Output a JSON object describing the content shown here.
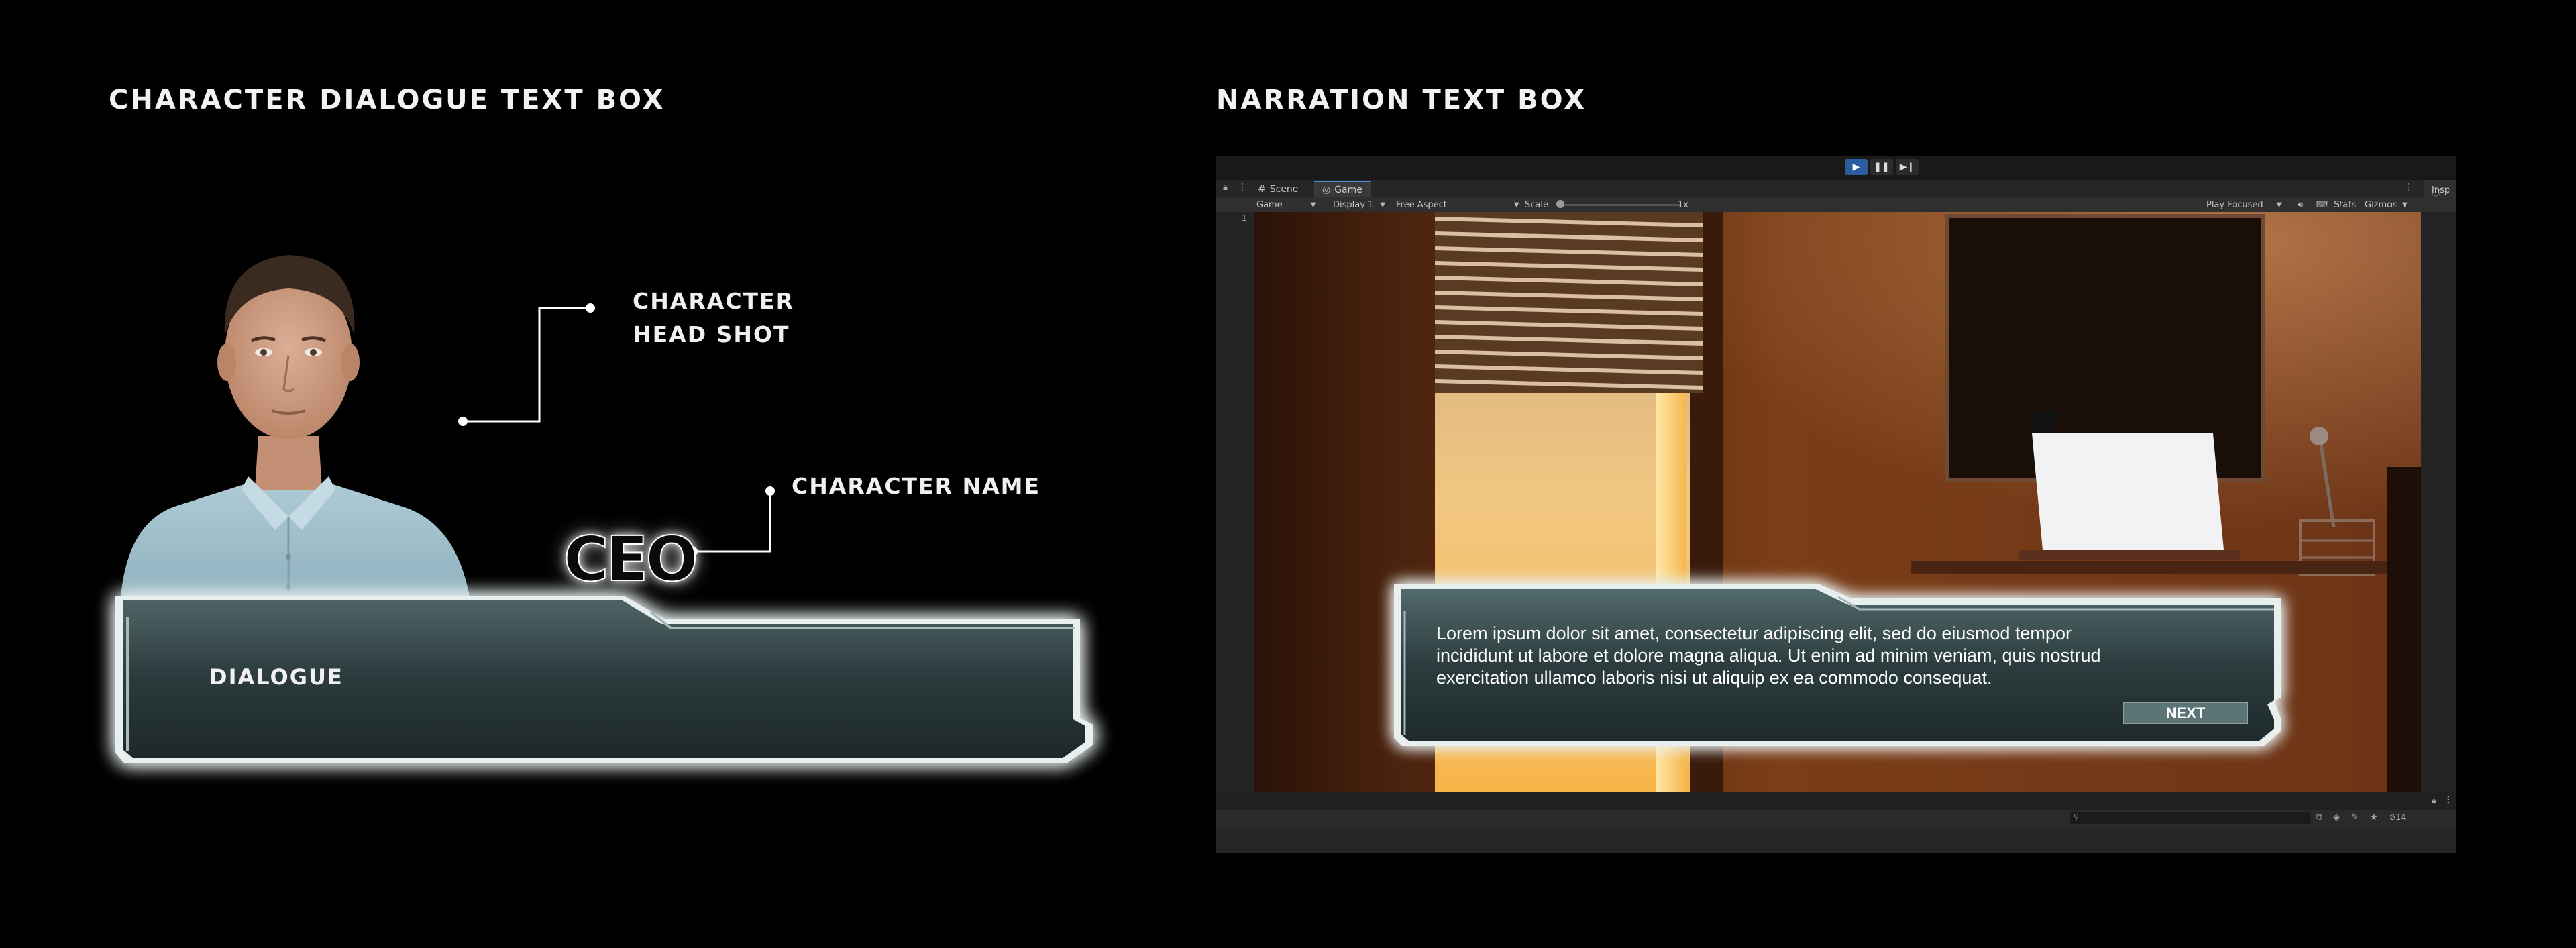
{
  "left_section": {
    "title": "CHARACTER DIALOGUE TEXT BOX",
    "headshot_label_line1": "CHARACTER",
    "headshot_label_line2": "HEAD SHOT",
    "name_callout_label": "CHARACTER NAME",
    "character_name": "CEO",
    "dialogue_placeholder": "DIALOGUE"
  },
  "right_section": {
    "title": "NARRATION TEXT BOX",
    "editor": {
      "tabs": [
        {
          "label": "Scene",
          "icon": "scene-grid-icon"
        },
        {
          "label": "Game",
          "icon": "game-controller-icon"
        }
      ],
      "inspector_label": "Insp",
      "toolbar": {
        "view_select": "Game",
        "display_select": "Display 1",
        "aspect_select": "Free Aspect",
        "scale_label": "Scale",
        "scale_value": "1x",
        "play_mode_select": "Play Focused",
        "stats_label": "Stats",
        "gizmos_label": "Gizmos"
      },
      "left_column_value": "1",
      "layers_count": "14"
    },
    "narration_text": "Lorem ipsum dolor sit amet, consectetur adipiscing elit, sed do eiusmod tempor incididunt ut labore et dolore magna aliqua. Ut enim ad minim veniam, quis nostrud exercitation ullamco laboris nisi ut aliquip ex ea commodo consequat.",
    "next_label": "NEXT"
  },
  "colors": {
    "background": "#000000",
    "panel_fill": "#283537",
    "panel_glow": "#ffffff",
    "next_button": "#5d7477",
    "editor_bg": "#202020",
    "play_active": "#2b5d9e"
  }
}
